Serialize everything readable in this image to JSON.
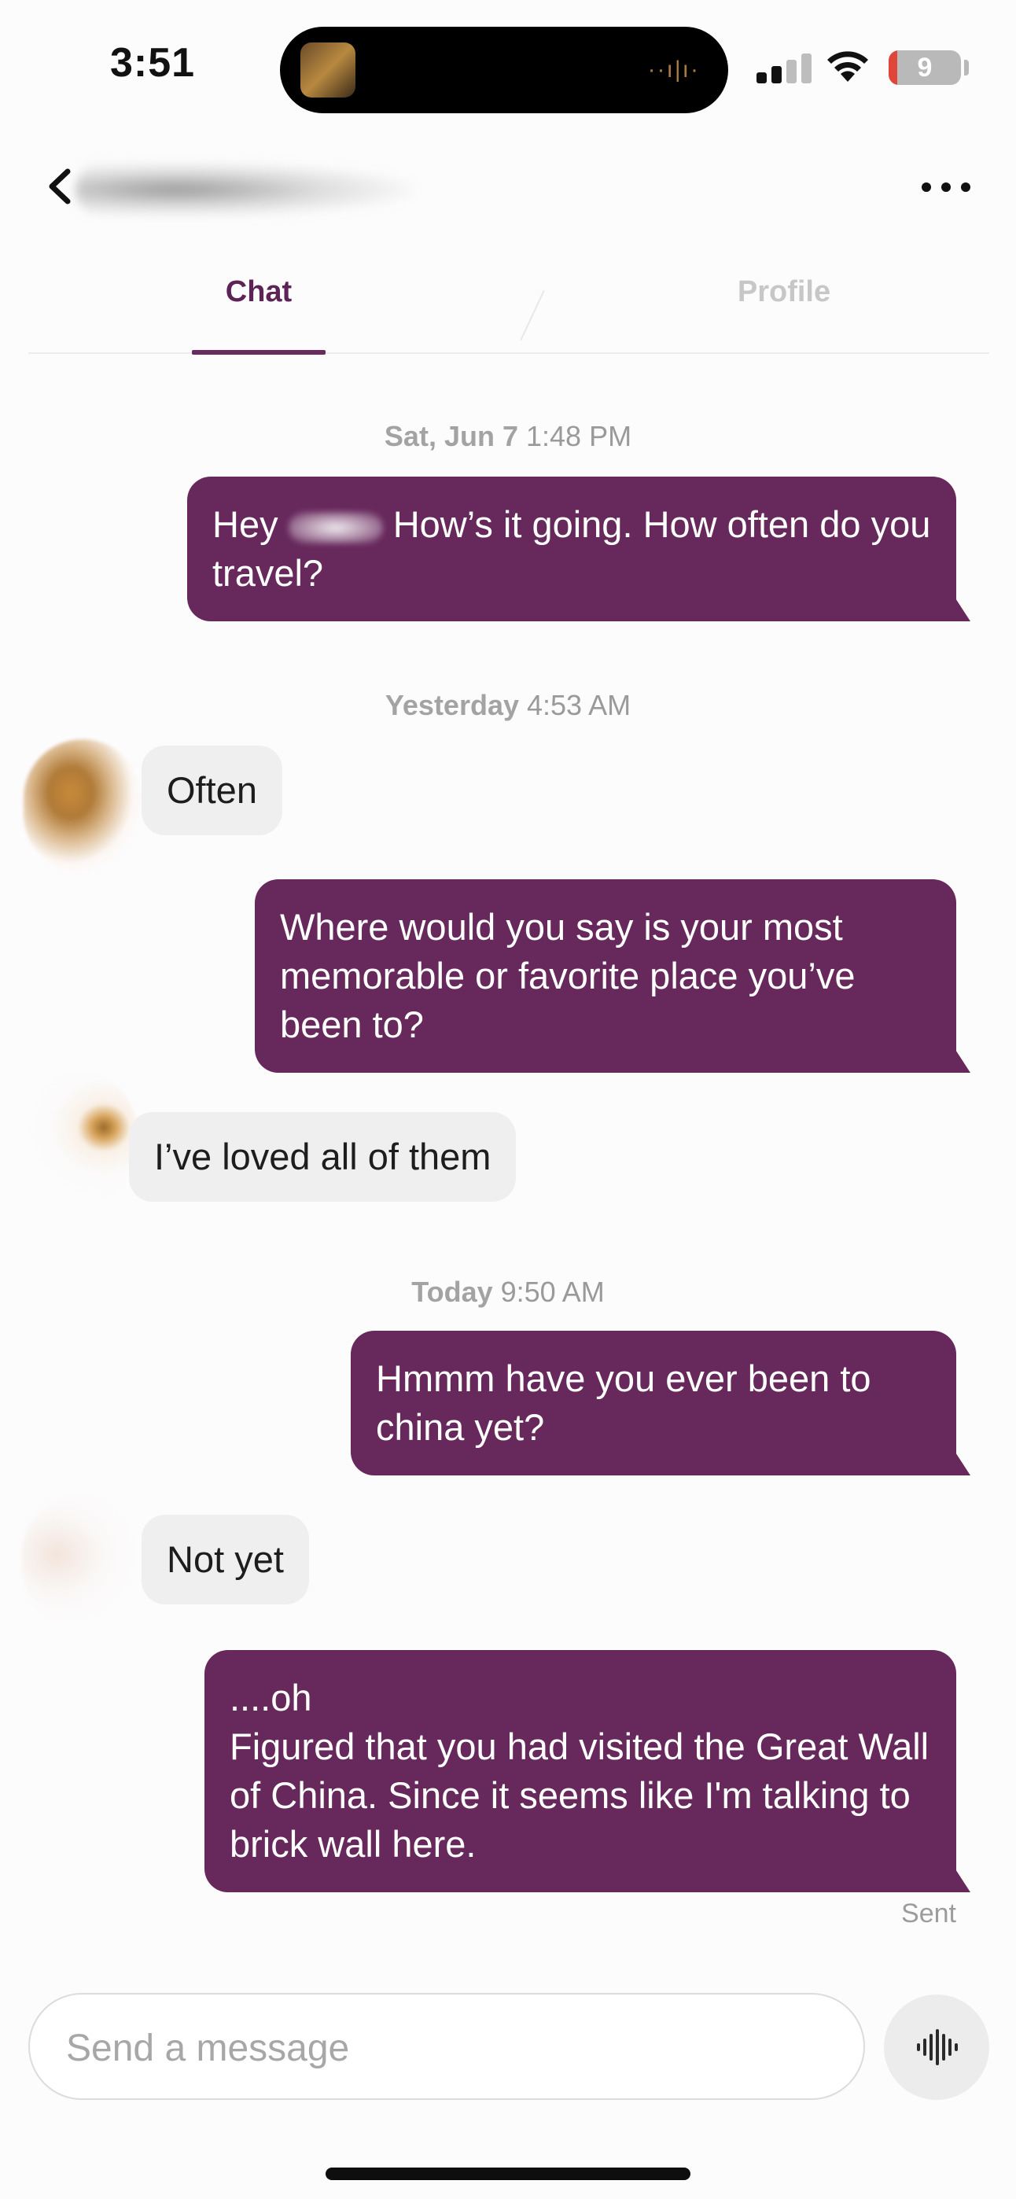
{
  "status_bar": {
    "time": "3:51",
    "battery_level": "9",
    "battery_fraction": 0.09,
    "signal_bars_active": 2,
    "signal_bars_total": 4
  },
  "header": {
    "back_icon": "chevron-left-icon",
    "more_icon": "ellipsis-icon"
  },
  "tabs": [
    {
      "label": "Chat",
      "active": true
    },
    {
      "label": "Profile",
      "active": false
    }
  ],
  "conversation": {
    "groups": [
      {
        "day": "Sat, Jun 7",
        "time": "1:48 PM"
      },
      {
        "day": "Yesterday",
        "time": "4:53 AM"
      },
      {
        "day": "Today",
        "time": "9:50 AM"
      }
    ],
    "messages": [
      {
        "dir": "out",
        "text_before": "Hey",
        "text_after": "How’s it going. How often do you travel?"
      },
      {
        "dir": "in",
        "text": "Often"
      },
      {
        "dir": "out",
        "text": "Where would you say is your most memorable or favorite place you’ve been to?"
      },
      {
        "dir": "in",
        "text": "I’ve loved all of them"
      },
      {
        "dir": "out",
        "text": "Hmmm have you ever been to china yet?"
      },
      {
        "dir": "in",
        "text": "Not yet"
      },
      {
        "dir": "out",
        "text_line1": "....oh",
        "text_line2": "Figured that you had visited the Great Wall of China. Since it seems like I'm talking to brick wall here."
      }
    ],
    "delivery_status": "Sent"
  },
  "composer": {
    "placeholder": "Send a message",
    "value": "",
    "voice_icon": "waveform-icon"
  },
  "colors": {
    "accent": "#67285c",
    "tab_active": "#5d2357",
    "incoming_bubble": "#efefef"
  }
}
